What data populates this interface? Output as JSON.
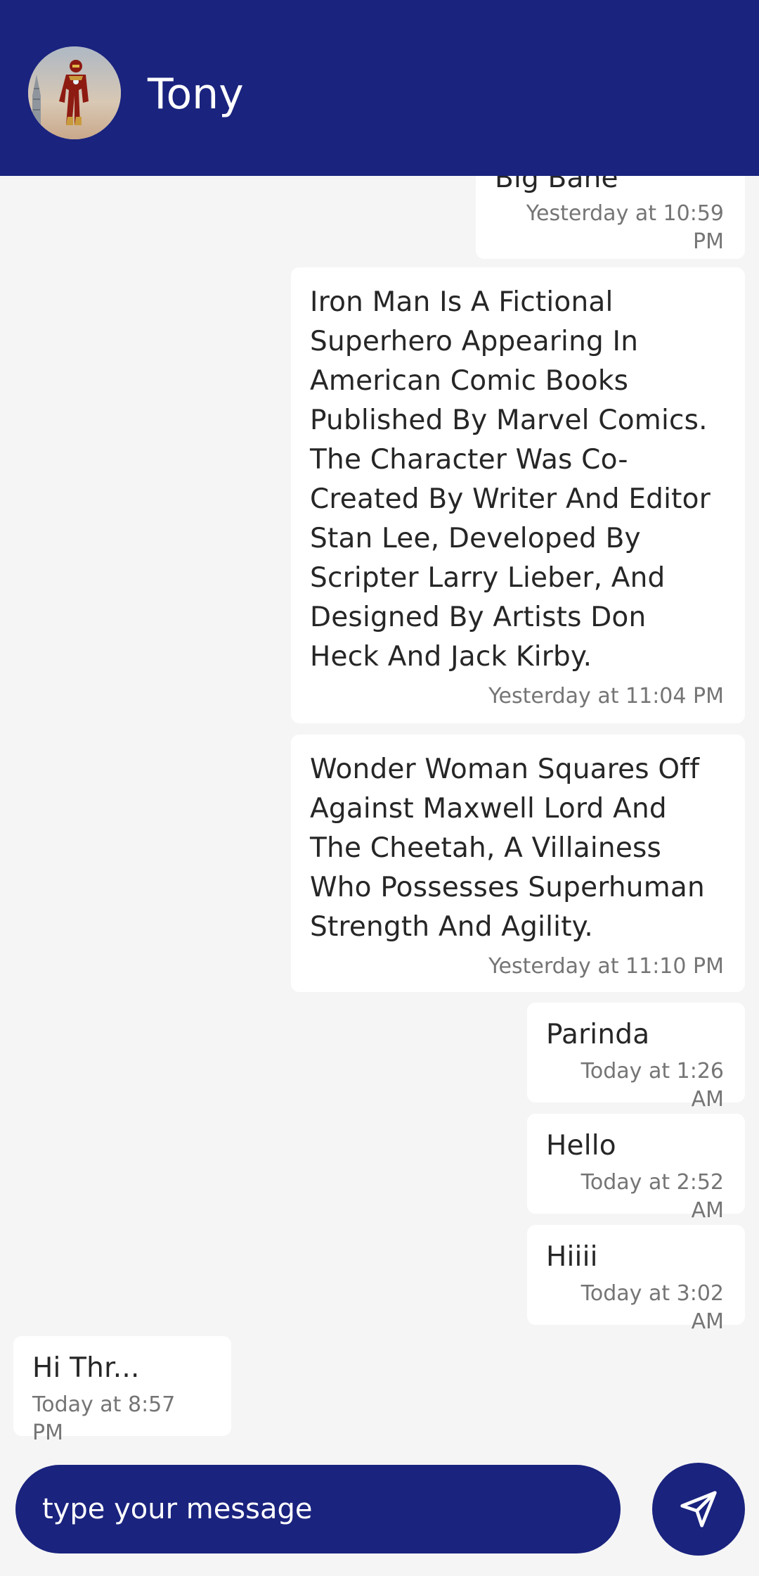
{
  "header": {
    "contact_name": "Tony",
    "avatar_icon": "iron-man-avatar",
    "background": "#1a237e"
  },
  "messages": [
    {
      "direction": "outgoing",
      "text": "Big Bane",
      "time": "Yesterday at 10:59 PM"
    },
    {
      "direction": "outgoing",
      "text": "Iron Man Is A Fictional Superhero Appearing In American Comic Books Published By Marvel Comics. The Character Was Co-Created By Writer And Editor Stan Lee, Developed By Scripter Larry Lieber, And Designed By Artists Don Heck And Jack Kirby.",
      "time": "Yesterday at 11:04 PM"
    },
    {
      "direction": "outgoing",
      "text": "Wonder Woman Squares Off Against Maxwell Lord And The Cheetah, A Villainess Who Possesses Superhuman Strength And Agility.",
      "time": "Yesterday at 11:10 PM"
    },
    {
      "direction": "outgoing",
      "text": "Parinda",
      "time": "Today at 1:26 AM"
    },
    {
      "direction": "outgoing",
      "text": "Hello",
      "time": "Today at 2:52 AM"
    },
    {
      "direction": "outgoing",
      "text": "Hiiii",
      "time": "Today at 3:02 AM"
    },
    {
      "direction": "incoming",
      "text": "Hi Thr...",
      "time": "Today at 8:57 PM"
    }
  ],
  "composer": {
    "placeholder": "type your message",
    "send_icon": "send-icon",
    "accent": "#1a237e"
  }
}
